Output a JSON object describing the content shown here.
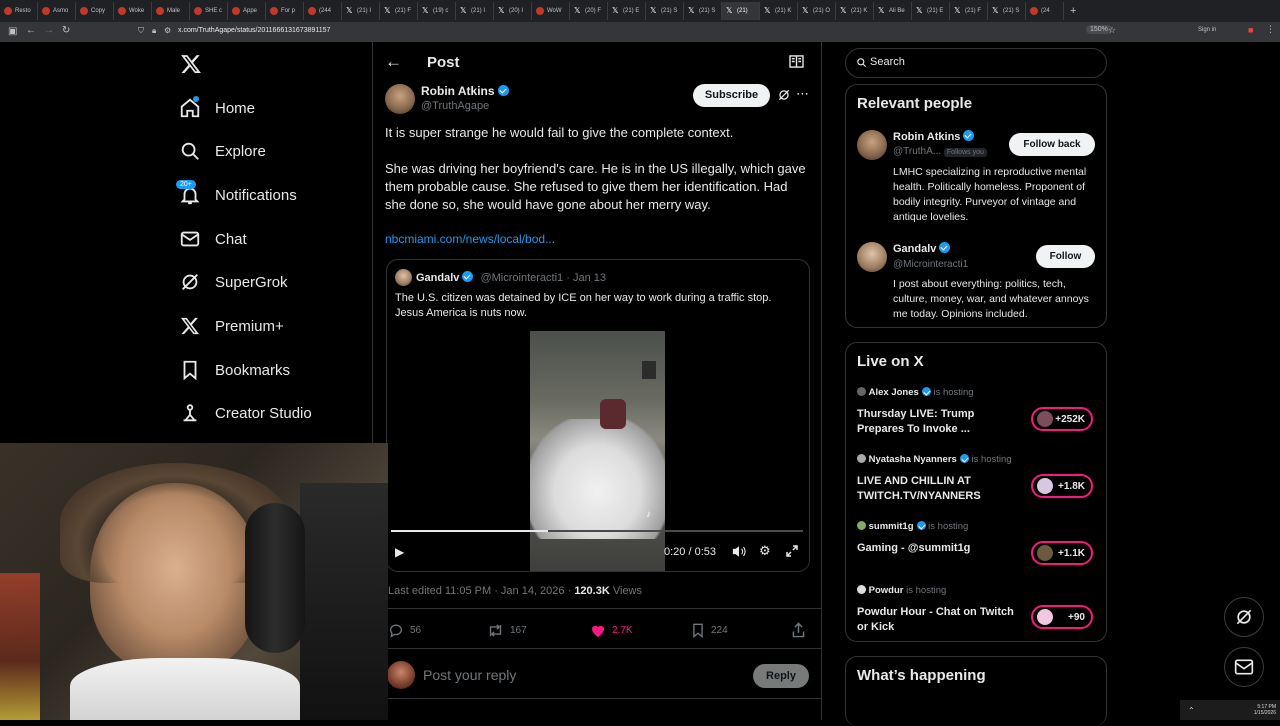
{
  "browser": {
    "tabs": [
      {
        "label": "Resto",
        "icon": "site-icon"
      },
      {
        "label": "Asmo",
        "icon": "site-icon"
      },
      {
        "label": "Copy",
        "icon": "site-icon"
      },
      {
        "label": "Woke",
        "icon": "site-icon"
      },
      {
        "label": "Male",
        "icon": "site-icon"
      },
      {
        "label": "SHE c",
        "icon": "site-icon"
      },
      {
        "label": "Appe",
        "icon": "site-icon"
      },
      {
        "label": "For p",
        "icon": "site-icon"
      },
      {
        "label": "(244",
        "icon": "site-icon"
      },
      {
        "label": "(21) I",
        "icon": "x-icon"
      },
      {
        "label": "(21) F",
        "icon": "x-icon"
      },
      {
        "label": "(19) c",
        "icon": "x-icon"
      },
      {
        "label": "(21) I",
        "icon": "x-icon"
      },
      {
        "label": "(20) I",
        "icon": "x-icon"
      },
      {
        "label": "WoW",
        "icon": "site-icon"
      },
      {
        "label": "(20) F",
        "icon": "x-icon"
      },
      {
        "label": "(21) E",
        "icon": "x-icon"
      },
      {
        "label": "(21) S",
        "icon": "x-icon"
      },
      {
        "label": "(21) S",
        "icon": "x-icon"
      },
      {
        "label": "(21)",
        "icon": "x-icon"
      },
      {
        "label": "(21) K",
        "icon": "x-icon"
      },
      {
        "label": "(21) O",
        "icon": "x-icon"
      },
      {
        "label": "(21) K",
        "icon": "x-icon"
      },
      {
        "label": "Ali Be",
        "icon": "x-icon"
      },
      {
        "label": "(21) E",
        "icon": "x-icon"
      },
      {
        "label": "(21) F",
        "icon": "x-icon"
      },
      {
        "label": "(21) S",
        "icon": "x-icon"
      },
      {
        "label": "(24",
        "icon": "site-icon"
      }
    ],
    "url": "x.com/TruthAgape/status/2011666131673891157",
    "zoom": "150%",
    "signin": "Sign in"
  },
  "nav": {
    "items": [
      {
        "label": "Home",
        "icon": "home-icon"
      },
      {
        "label": "Explore",
        "icon": "search-icon"
      },
      {
        "label": "Notifications",
        "icon": "bell-icon"
      },
      {
        "label": "Chat",
        "icon": "mail-icon"
      },
      {
        "label": "SuperGrok",
        "icon": "grok-icon"
      },
      {
        "label": "Premium+",
        "icon": "x-logo-icon"
      },
      {
        "label": "Bookmarks",
        "icon": "bookmark-icon"
      },
      {
        "label": "Creator Studio",
        "icon": "creator-icon"
      }
    ],
    "notifications_badge": "20+"
  },
  "post": {
    "header": "Post",
    "author_name": "Robin Atkins",
    "author_handle": "@TruthAgape",
    "subscribe": "Subscribe",
    "text_line1": "It is super strange he would fail to give the complete context.",
    "text_para2": "She was driving her boyfriend's care. He is in the US illegally, which gave them probable cause. She refused to give them her identification. Had she done so, she would have gone about her merry way.",
    "link": "nbcmiami.com/news/local/bod...",
    "quote": {
      "author_name": "Gandalv",
      "author_handle": "@Microinteracti1",
      "date": "· Jan 13",
      "text": "The U.S. citizen was detained by ICE on her way to work during a traffic stop. Jesus America is nuts now.",
      "video_time": "0:20 / 0:53",
      "video_progress": 0.38
    },
    "edited": "Last edited 11:05 PM · Jan 14, 2026 ·",
    "views_count": "120.3K",
    "views_label": "Views",
    "stats": {
      "replies": "56",
      "reposts": "167",
      "likes": "2.7K",
      "bookmarks": "224"
    },
    "reply_placeholder": "Post your reply",
    "reply_button": "Reply"
  },
  "sidebar": {
    "search_placeholder": "Search",
    "relevant_title": "Relevant people",
    "people": [
      {
        "name": "Robin Atkins",
        "handle": "@TruthA...",
        "follows_you": "Follows you",
        "button": "Follow back",
        "bio": "LMHC specializing in reproductive mental health. Politically homeless. Proponent of bodily integrity. Purveyor of vintage and antique lovelies."
      },
      {
        "name": "Gandalv",
        "handle": "@Microinteracti1",
        "button": "Follow",
        "bio": "I post about everything: politics, tech, culture, money, war, and whatever annoys me today. Opinions included."
      }
    ],
    "live_title": "Live on X",
    "live": [
      {
        "host": "Alex Jones",
        "status": "is hosting",
        "title": "Thursday LIVE: Trump Prepares To Invoke ...",
        "count": "+252K"
      },
      {
        "host": "Nyatasha Nyanners",
        "status": "is hosting",
        "title": "LIVE AND CHILLIN AT TWITCH.TV/NYANNERS",
        "count": "+1.8K"
      },
      {
        "host": "summit1g",
        "status": "is hosting",
        "title": "Gaming - @summit1g",
        "count": "+1.1K"
      },
      {
        "host": "Powdur",
        "status": "is hosting",
        "title": "Powdur Hour - Chat on Twitch or Kick",
        "count": "+90"
      }
    ],
    "happening_title": "What’s happening"
  },
  "taskbar": {
    "time": "5:17 PM",
    "date": "1/15/2026"
  },
  "colors": {
    "accent": "#1d9bf0",
    "like": "#f91880",
    "background": "#000000",
    "border": "#2f3336"
  }
}
